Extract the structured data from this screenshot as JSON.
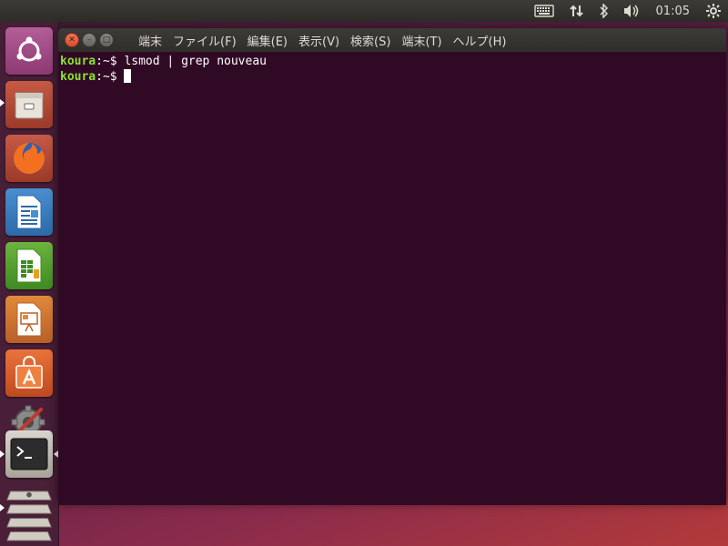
{
  "top_panel": {
    "icons": [
      "keyboard-icon",
      "network-icon",
      "bluetooth-icon",
      "volume-icon",
      "power-gear-icon"
    ],
    "clock": "01:05"
  },
  "launcher": {
    "items": [
      "ubuntu-dash",
      "files",
      "firefox",
      "libreoffice-writer",
      "libreoffice-calc",
      "libreoffice-impress",
      "software-center",
      "system-settings",
      "terminal",
      "more-apps"
    ]
  },
  "window": {
    "menu": [
      "端末",
      "ファイル(F)",
      "編集(E)",
      "表示(V)",
      "検索(S)",
      "端末(T)",
      "ヘルプ(H)"
    ]
  },
  "terminal": {
    "prompt_user": "koura",
    "prompt_path": ":~$",
    "command1": "lsmod | grep nouveau"
  },
  "colors": {
    "terminal_bg": "#300a24",
    "prompt_green": "#8ae234",
    "close_orange": "#e95420"
  }
}
